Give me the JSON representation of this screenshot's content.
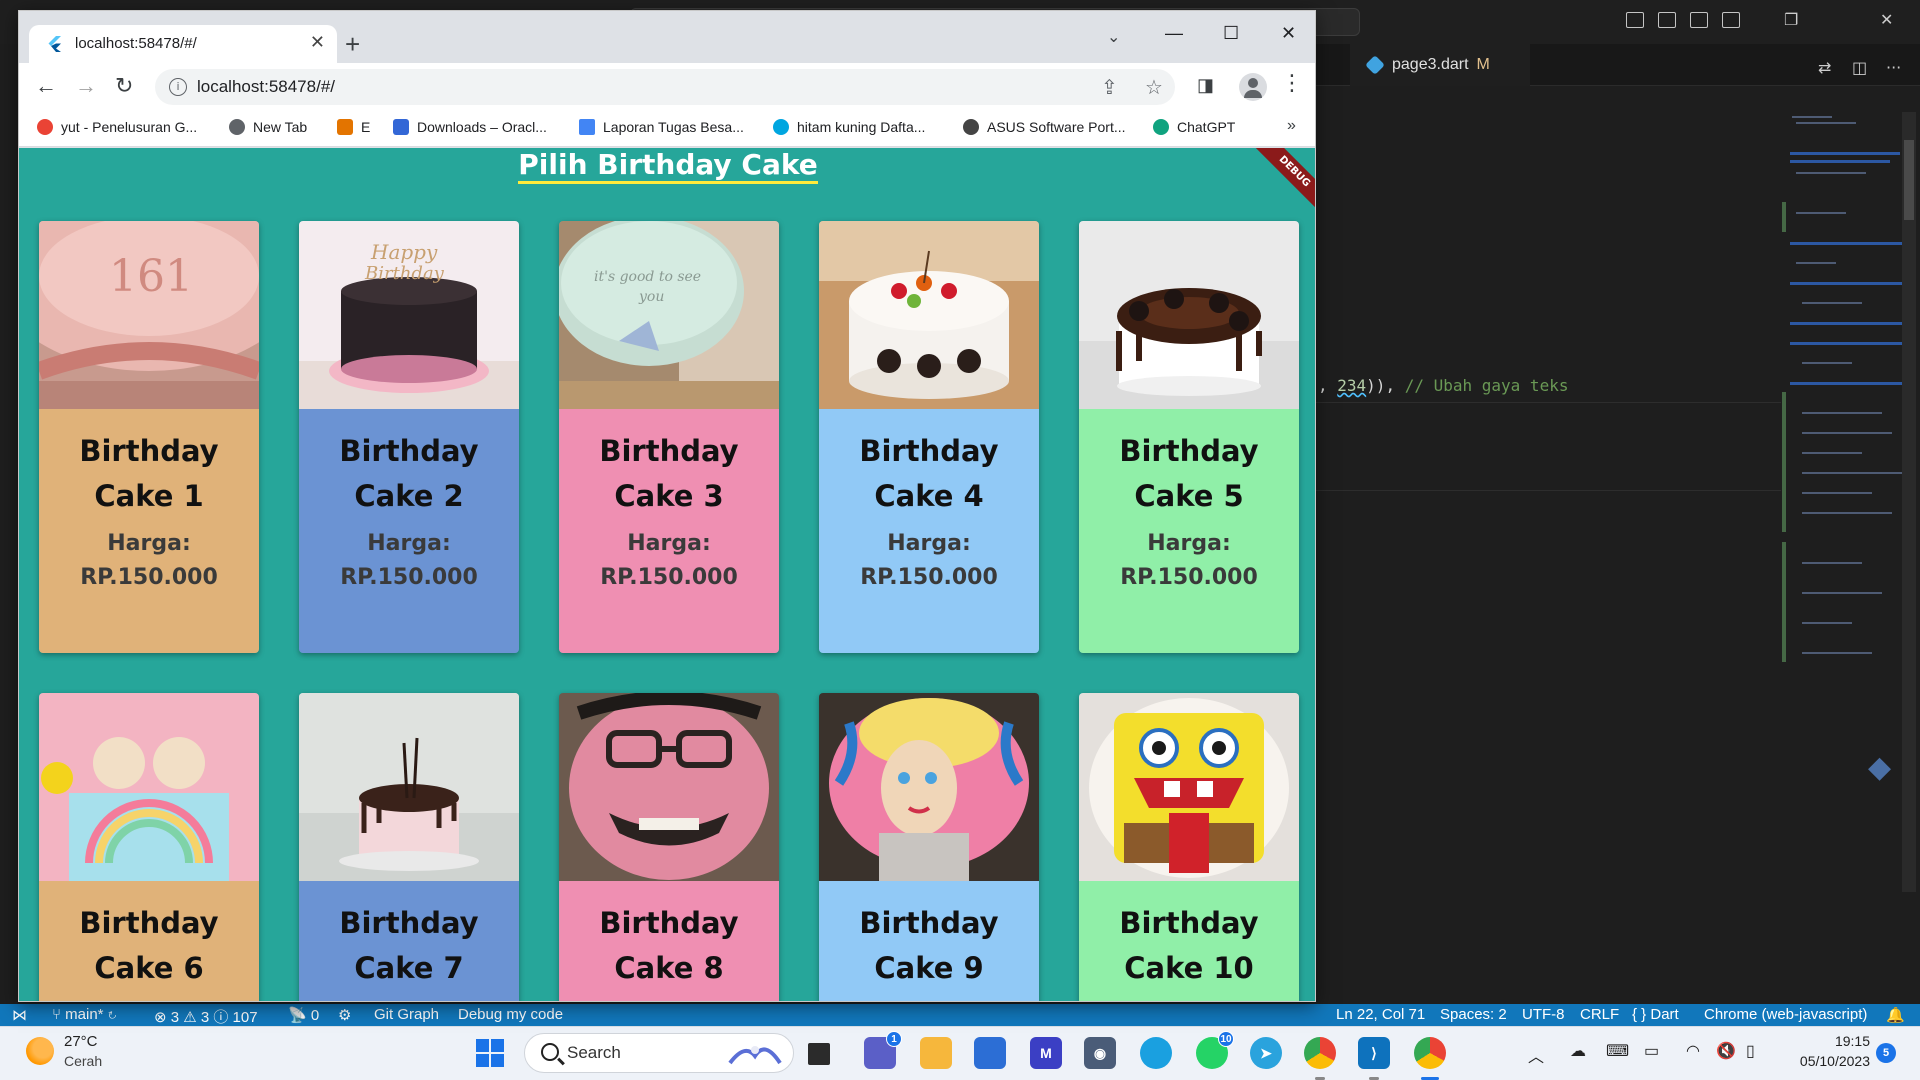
{
  "vscode": {
    "tab_label": "page3.dart",
    "tab_modified": "M",
    "code_prefix": ", ",
    "code_number": "234",
    "code_suffix": ")), ",
    "code_comment": "// Ubah gaya teks"
  },
  "statusbar": {
    "branch": "main*",
    "problems": "⊗ 3 ⚠ 3 ⓘ 107",
    "ports": "0",
    "git_graph": "Git Graph",
    "debug": "Debug my code",
    "position": "Ln 22, Col 71",
    "spaces": "Spaces: 2",
    "encoding": "UTF-8",
    "eol": "CRLF",
    "language": "Dart",
    "device": "Chrome (web-javascript)"
  },
  "browser": {
    "tab_title": "localhost:58478/#/",
    "url": "localhost:58478/#/",
    "bookmarks": [
      {
        "label": "yut - Penelusuran G...",
        "color": "#ea4335"
      },
      {
        "label": "New Tab",
        "color": "#5f6368"
      },
      {
        "label": "E",
        "color": "#e37400"
      },
      {
        "label": "Downloads – Oracl...",
        "color": "#3367d6"
      },
      {
        "label": "Laporan Tugas Besa...",
        "color": "#4285f4"
      },
      {
        "label": "hitam kuning Dafta...",
        "color": "#00a6e0"
      },
      {
        "label": "ASUS Software Port...",
        "color": "#444444"
      },
      {
        "label": "ChatGPT",
        "color": "#10a37f"
      }
    ],
    "bookmarks_more": "»"
  },
  "app": {
    "title": "Pilih Birthday Cake",
    "debug_banner": "DEBUG",
    "price_label": "Harga:",
    "cards": [
      {
        "name": "Birthday Cake 1",
        "price": "RP.150.000",
        "bg": "#e0b279"
      },
      {
        "name": "Birthday Cake 2",
        "price": "RP.150.000",
        "bg": "#6b93d3"
      },
      {
        "name": "Birthday Cake 3",
        "price": "RP.150.000",
        "bg": "#ef8fb2"
      },
      {
        "name": "Birthday Cake 4",
        "price": "RP.150.000",
        "bg": "#91c9f6"
      },
      {
        "name": "Birthday Cake 5",
        "price": "RP.150.000",
        "bg": "#90efa8"
      },
      {
        "name": "Birthday Cake 6",
        "price": "",
        "bg": "#e0b279"
      },
      {
        "name": "Birthday Cake 7",
        "price": "",
        "bg": "#6b93d3"
      },
      {
        "name": "Birthday Cake 8",
        "price": "",
        "bg": "#ef8fb2"
      },
      {
        "name": "Birthday Cake 9",
        "price": "",
        "bg": "#91c9f6"
      },
      {
        "name": "Birthday Cake 10",
        "price": "",
        "bg": "#90efa8"
      }
    ]
  },
  "taskbar": {
    "temperature": "27°C",
    "weather": "Cerah",
    "search_placeholder": "Search",
    "time": "19:15",
    "date": "05/10/2023",
    "notifications": "5",
    "badge_chat": "1",
    "badge_whatsapp": "10"
  }
}
